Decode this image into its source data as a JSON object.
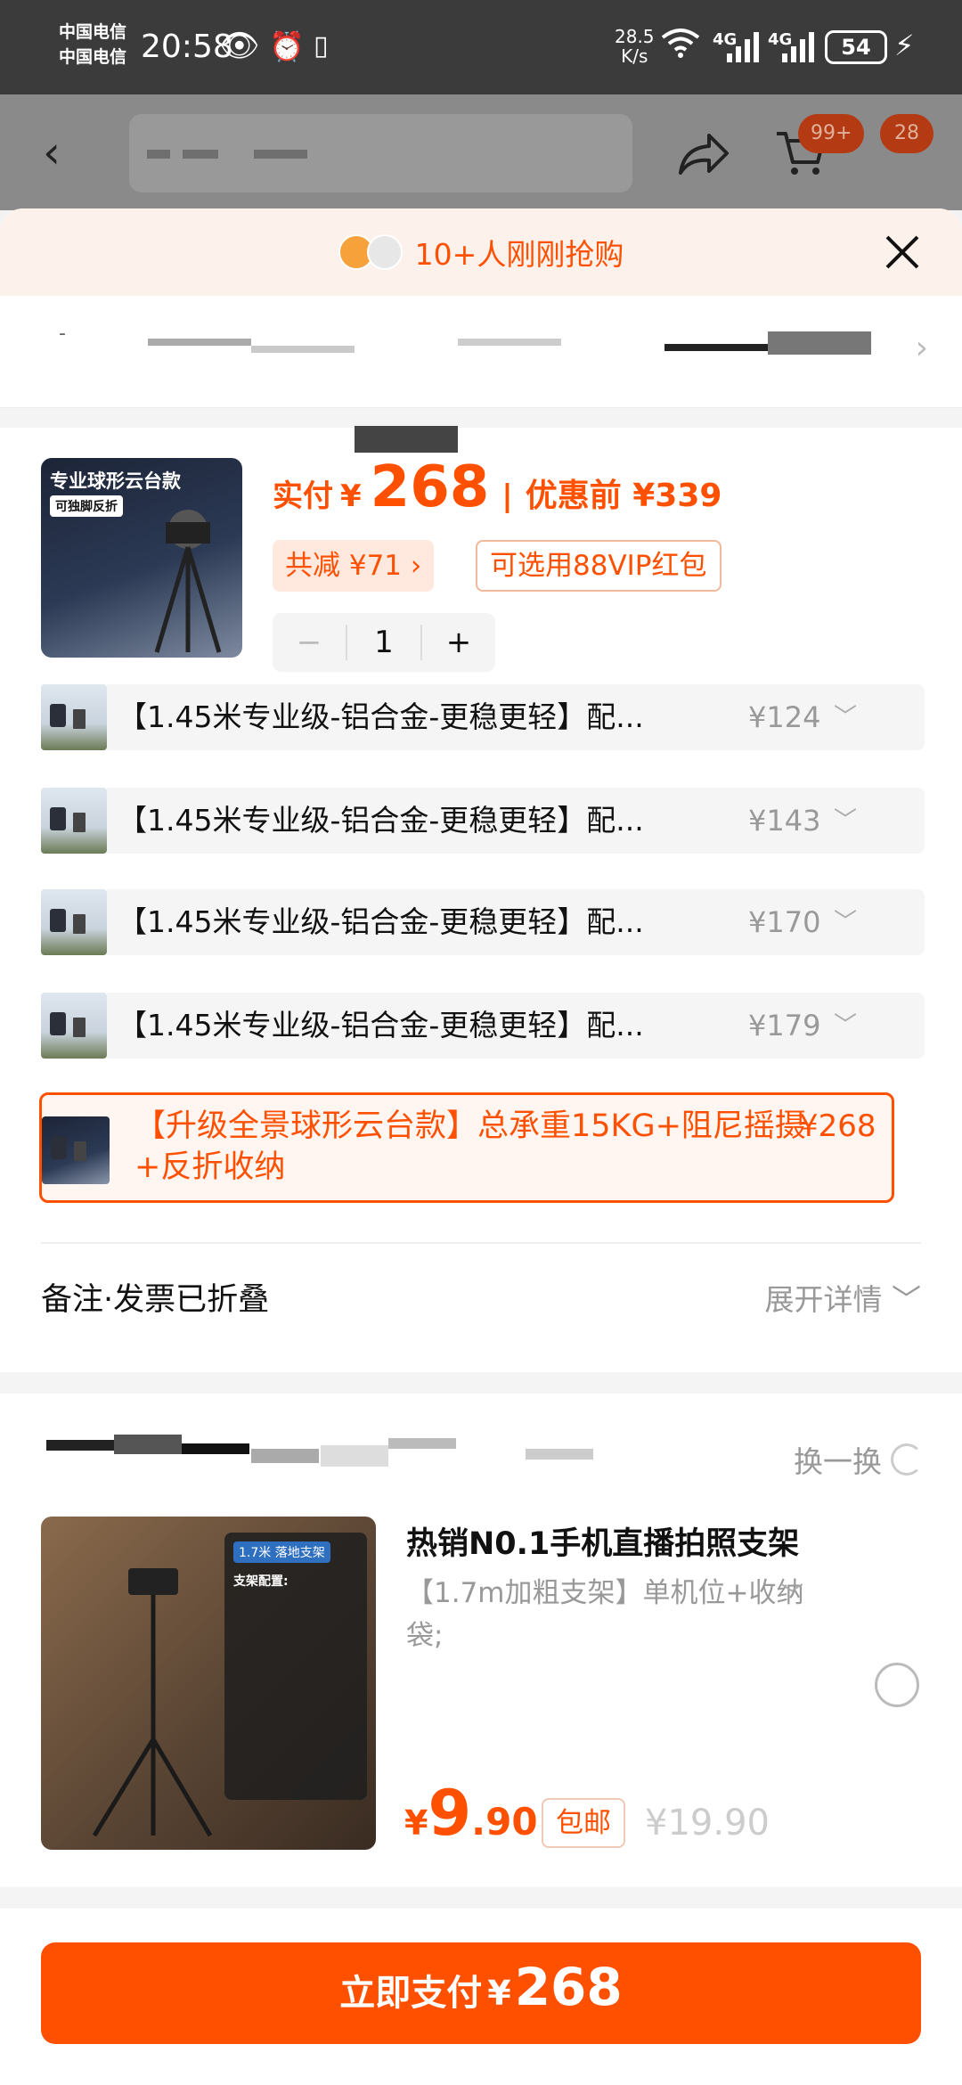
{
  "status_bar": {
    "carrier_1": "中国电信",
    "carrier_2": "中国电信",
    "time": "20:58",
    "net_speed_value": "28.5",
    "net_speed_unit": "K/s",
    "signal_1": "4G",
    "signal_2": "4G",
    "battery": "54"
  },
  "header": {
    "cart_badge": "99+",
    "message_badge": "28"
  },
  "promo_banner": {
    "text": "10+人刚刚抢购"
  },
  "product": {
    "thumb_title": "专业球形云台款",
    "thumb_tag": "可独脚反折",
    "paid_label": "实付",
    "currency": "¥",
    "paid_amount": "268",
    "separator": "|",
    "before_discount_label": "优惠前 ¥339",
    "save_chip": "共减 ¥71 ›",
    "vip_chip": "可选用88VIP红包",
    "quantity": "1",
    "minus": "−",
    "plus": "+"
  },
  "variants": [
    {
      "name": "【1.45米专业级-铝合金-更稳更轻】配...",
      "price": "¥124"
    },
    {
      "name": "【1.45米专业级-铝合金-更稳更轻】配...",
      "price": "¥143"
    },
    {
      "name": "【1.45米专业级-铝合金-更稳更轻】配...",
      "price": "¥170"
    },
    {
      "name": "【1.45米专业级-铝合金-更稳更轻】配...",
      "price": "¥179"
    }
  ],
  "selected_variant": {
    "name": "【升级全景球形云台款】总承重15KG+阻尼摇摄+反折收纳",
    "price": "¥268"
  },
  "remark": {
    "label": "备注·发票已折叠",
    "expand": "展开详情"
  },
  "recommendation": {
    "swap_label": "换一换",
    "thumb_tag": "1.7米 落地支架",
    "thumb_config": "支架配置:",
    "name": "热销N0.1手机直播拍照支架",
    "spec": "【1.7m加粗支架】单机位+收纳袋;",
    "price_yen": "¥",
    "price_int": "9",
    "price_dec": ".90",
    "free_shipping": "包邮",
    "original_price": "¥19.90"
  },
  "pay_button": {
    "label": "立即支付",
    "currency": "¥",
    "amount": "268"
  },
  "colors": {
    "accent": "#ff5000",
    "overlay": "#8a8a8a"
  }
}
